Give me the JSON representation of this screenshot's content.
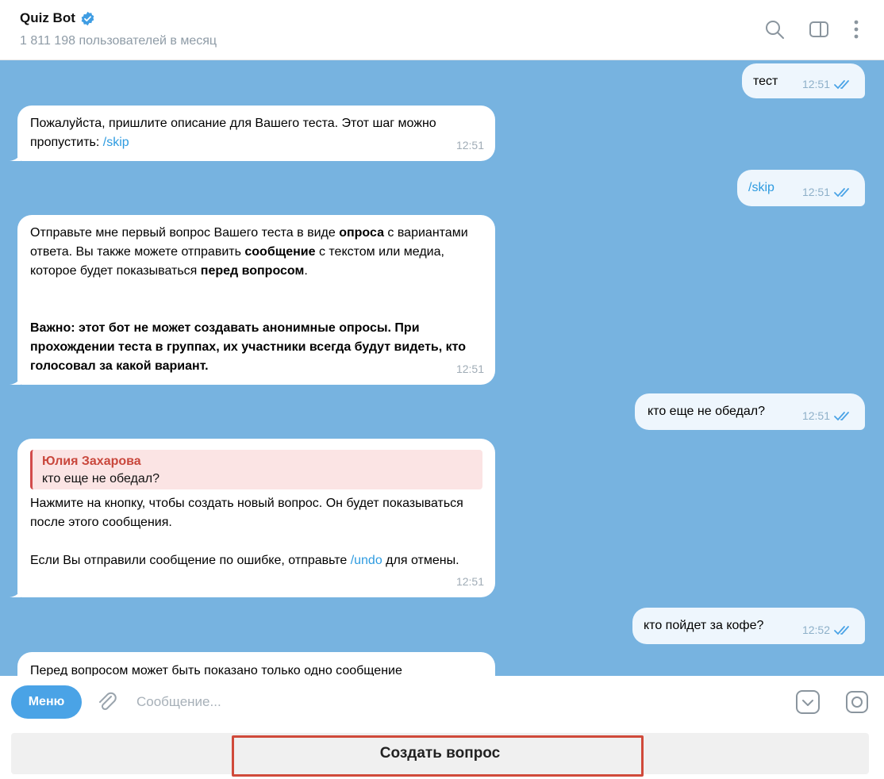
{
  "header": {
    "title": "Quiz Bot",
    "subtitle": "1 811 198 пользователей в месяц"
  },
  "messages": [
    {
      "dir": "out",
      "text": "тест",
      "time": "12:51"
    },
    {
      "dir": "in",
      "text_a": "Пожалуйста, пришлите описание для Вашего теста. Этот шаг можно пропустить: ",
      "link": "/skip",
      "time": "12:51"
    },
    {
      "dir": "out",
      "link": "/skip",
      "time": "12:51"
    },
    {
      "dir": "in",
      "p1_a": "Отправьте мне первый вопрос Вашего теста в виде ",
      "p1_b": "опроса",
      "p1_c": " с вариантами ответа. Вы также можете отправить ",
      "p1_d": "сообщение",
      "p1_e": " с текстом или медиа, которое будет показываться ",
      "p1_f": "перед вопросом",
      "p1_g": ".",
      "p2": "Важно: этот бот не может создавать анонимные опросы. При прохождении теста в группах, их участники всегда будут видеть, кто голосовал за какой вариант.",
      "time": "12:51"
    },
    {
      "dir": "out",
      "text": "кто еще не обедал?",
      "time": "12:51"
    },
    {
      "dir": "in",
      "reply_name": "Юлия Захарова",
      "reply_text": "кто еще не обедал?",
      "p1": "Нажмите на кнопку, чтобы создать новый вопрос. Он будет показываться после этого сообщения.",
      "p2_a": "Если Вы отправили сообщение по ошибке, отправьте ",
      "p2_link": "/undo",
      "p2_b": " для отмены.",
      "time": "12:51"
    },
    {
      "dir": "out",
      "text": "кто пойдет за кофе?",
      "time": "12:52"
    },
    {
      "dir": "in",
      "text": "Перед вопросом может быть показано только одно сообщение"
    }
  ],
  "input": {
    "menu_label": "Меню",
    "placeholder": "Сообщение..."
  },
  "keyboard": {
    "create_label": "Создать вопрос"
  },
  "colors": {
    "chat_bg": "#77b3e0",
    "accent": "#4aa3e6",
    "highlight": "#d04a3a"
  }
}
